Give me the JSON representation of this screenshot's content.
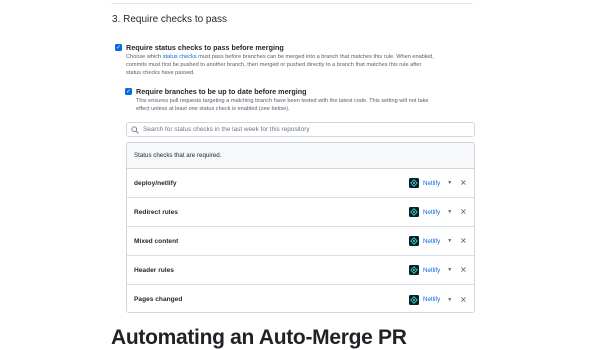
{
  "section": {
    "title": "3. Require checks to pass"
  },
  "require_status_checks": {
    "label": "Require status checks to pass before merging",
    "checked": true,
    "description_before_link": "Choose which ",
    "description_link": "status checks",
    "description_line1_after": " must pass before branches can be merged into a branch that matches this rule. When enabled,",
    "description_line2": "commits must first be pushed to another branch, then merged or pushed directly to a branch that matches this rule after",
    "description_line3": "status checks have passed."
  },
  "require_up_to_date": {
    "label": "Require branches to be up to date before merging",
    "checked": true,
    "description_line1": "This ensures pull requests targeting a matching branch have been tested with the latest code. This setting will not take",
    "description_line2": "effect unless at least one status check is enabled (see below)."
  },
  "search": {
    "placeholder": "Search for status checks in the last week for this repository",
    "icon": "search-icon"
  },
  "status_table": {
    "header": "Status checks that are required.",
    "rows": [
      {
        "name": "deploy/netlify",
        "provider": "Netlify"
      },
      {
        "name": "Redirect rules",
        "provider": "Netlify"
      },
      {
        "name": "Mixed content",
        "provider": "Netlify"
      },
      {
        "name": "Header rules",
        "provider": "Netlify"
      },
      {
        "name": "Pages changed",
        "provider": "Netlify"
      }
    ]
  },
  "next_section": {
    "heading": "Automating an Auto-Merge PR"
  },
  "colors": {
    "accent": "#0969da",
    "netlify_bg": "#0e1e25",
    "netlify_mark": "#32e6e2"
  }
}
